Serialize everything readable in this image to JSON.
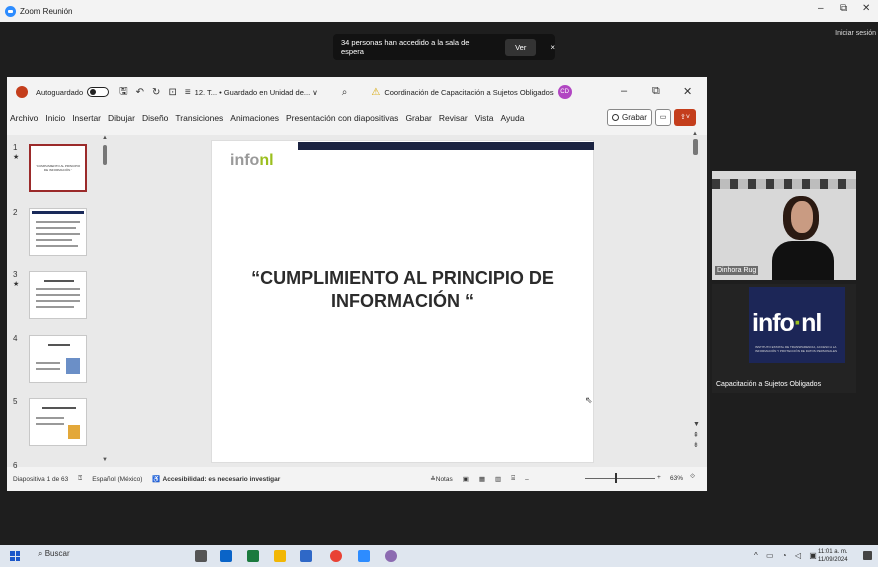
{
  "zoom": {
    "title": "Zoom Reunión",
    "signin": "Iniciar sesión",
    "banner_text": "34 personas han accedido a la sala de espera",
    "banner_button": "Ver",
    "banner_close": "×"
  },
  "ppt": {
    "autosave_label": "Autoguardado",
    "doc_title": "12. T... • Guardado en Unidad de... ∨",
    "org_label": "Coordinación de Capacitación a Sujetos Obligados",
    "user_initials": "CD",
    "menu": [
      "Archivo",
      "Inicio",
      "Insertar",
      "Dibujar",
      "Diseño",
      "Transiciones",
      "Animaciones",
      "Presentación con diapositivas",
      "Grabar",
      "Revisar",
      "Vista",
      "Ayuda"
    ],
    "record_button": "Grabar",
    "slide_numbers": [
      "1",
      "2",
      "3",
      "4",
      "5",
      "6"
    ],
    "slide_headline": "“CUMPLIMIENTO AL PRINCIPIO DE INFORMACIÓN “",
    "logo_text": "info",
    "logo_accent": "nl",
    "status": {
      "slide_count": "Diapositiva 1 de 63",
      "language": "Español (México)",
      "accessibility": "Accesibilidad: es necesario investigar",
      "notes": "Notas",
      "zoom": "63%"
    }
  },
  "participants": {
    "p1_name": "Dinhora Rug",
    "p2_logo_main": "info",
    "p2_logo_dot": "·",
    "p2_logo_end": "nl",
    "p2_logo_sub": "INSTITUTO ESTATAL DE TRANSPARENCIA, ACCESO A LA INFORMACIÓN Y PROTECCIÓN DE DATOS PERSONALES",
    "p2_name": "Capacitación a Sujetos Obligados"
  },
  "taskbar": {
    "search": "Buscar",
    "time": "11:01 a. m.",
    "date": "11/09/2024"
  },
  "colors": {
    "ppt_accent": "#c43e1c",
    "navy": "#1a2240",
    "lime": "#9bbf1e"
  }
}
